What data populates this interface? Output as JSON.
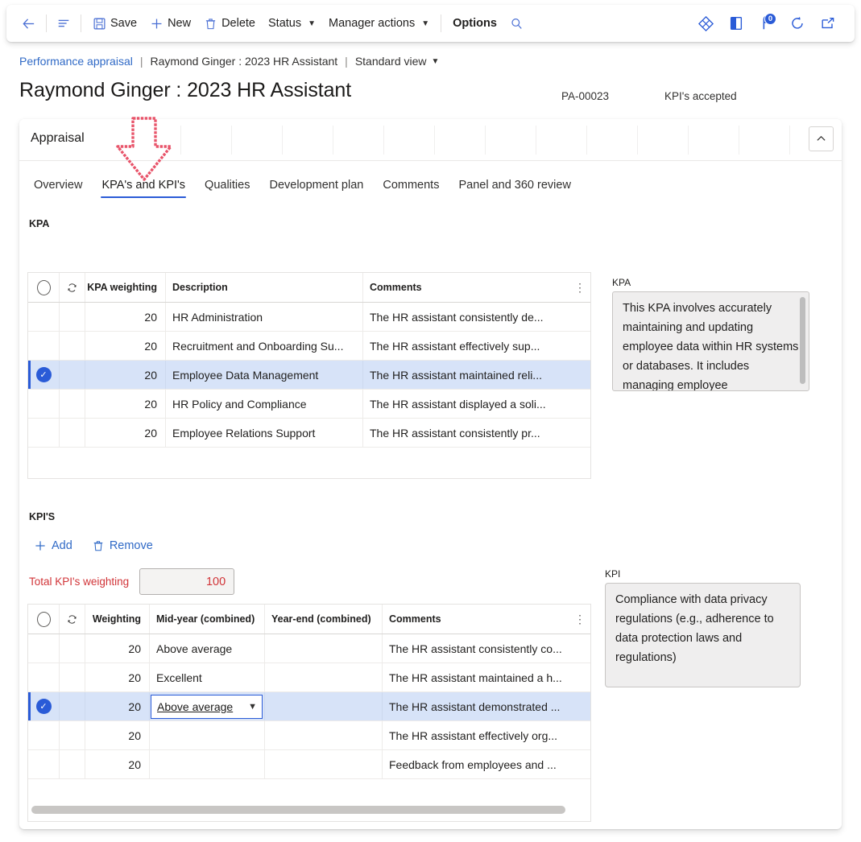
{
  "toolbar": {
    "back_label": "Back",
    "showlist_label": "Show list",
    "save_label": "Save",
    "new_label": "New",
    "delete_label": "Delete",
    "status_label": "Status",
    "manager_actions_label": "Manager actions",
    "options_label": "Options",
    "search_label": "Search",
    "right_icons": [
      {
        "name": "diamond-icon",
        "glyph": "◈"
      },
      {
        "name": "office-icon",
        "glyph": "◧"
      },
      {
        "name": "notifications-icon",
        "glyph": "P",
        "badge": "0"
      },
      {
        "name": "refresh-icon",
        "glyph": "↻"
      },
      {
        "name": "open-in-new-icon",
        "glyph": "⇱"
      }
    ]
  },
  "breadcrumb": {
    "module": "Performance appraisal",
    "separator": "|",
    "record": "Raymond Ginger : 2023 HR Assistant",
    "view": "Standard view"
  },
  "header": {
    "title": "Raymond Ginger : 2023 HR Assistant",
    "record_id": "PA-00023",
    "status": "KPI's accepted"
  },
  "panel": {
    "title": "Appraisal",
    "collapse_tooltip": "Collapse"
  },
  "tabs": [
    {
      "label": "Overview",
      "active": false
    },
    {
      "label": "KPA's and KPI's",
      "active": true
    },
    {
      "label": "Qualities",
      "active": false
    },
    {
      "label": "Development plan",
      "active": false
    },
    {
      "label": "Comments",
      "active": false
    },
    {
      "label": "Panel and 360 review",
      "active": false
    }
  ],
  "kpa": {
    "section_label": "KPA",
    "columns": [
      "KPA weighting",
      "Description",
      "Comments"
    ],
    "rows": [
      {
        "selected": false,
        "weighting": "20",
        "description": "HR Administration",
        "comments": "The HR assistant consistently de..."
      },
      {
        "selected": false,
        "weighting": "20",
        "description": "Recruitment and Onboarding Su...",
        "comments": "The HR assistant effectively sup..."
      },
      {
        "selected": true,
        "weighting": "20",
        "description": "Employee Data Management",
        "comments": "The HR assistant maintained reli..."
      },
      {
        "selected": false,
        "weighting": "20",
        "description": "HR Policy and Compliance",
        "comments": "The HR assistant displayed a soli..."
      },
      {
        "selected": false,
        "weighting": "20",
        "description": "Employee Relations Support",
        "comments": "The HR assistant consistently pr..."
      }
    ],
    "side_label": "KPA",
    "side_text": "This KPA involves accurately maintaining and updating employee data within HR systems or databases. It includes managing employee"
  },
  "kpi": {
    "section_label": "KPI'S",
    "add_label": "Add",
    "remove_label": "Remove",
    "total_label": "Total KPI's weighting",
    "total_value": "100",
    "columns": [
      "Weighting",
      "Mid-year (combined)",
      "Year-end (combined)",
      "Comments"
    ],
    "rows": [
      {
        "selected": false,
        "weighting": "20",
        "midyear": "Above average",
        "yearend": "",
        "comments": "The HR assistant consistently co..."
      },
      {
        "selected": false,
        "weighting": "20",
        "midyear": "Excellent",
        "yearend": "",
        "comments": "The HR assistant maintained a h..."
      },
      {
        "selected": true,
        "weighting": "20",
        "midyear": "Above average",
        "yearend": "",
        "comments": "The HR assistant demonstrated ..."
      },
      {
        "selected": false,
        "weighting": "20",
        "midyear": "",
        "yearend": "",
        "comments": " The HR assistant effectively org..."
      },
      {
        "selected": false,
        "weighting": "20",
        "midyear": "",
        "yearend": "",
        "comments": "Feedback from employees and ..."
      }
    ],
    "editing_value": "Above average",
    "side_label": "KPI",
    "side_text": "Compliance with data privacy regulations (e.g., adherence to data protection laws and regulations)"
  },
  "annotation": {
    "arrow_color": "#e8546a",
    "points_to": "KPA's and KPI's"
  },
  "colors": {
    "accent": "#2a5bd7",
    "link": "#2f69c6",
    "selection_row": "#d7e3f8",
    "warning_text": "#d13438"
  }
}
